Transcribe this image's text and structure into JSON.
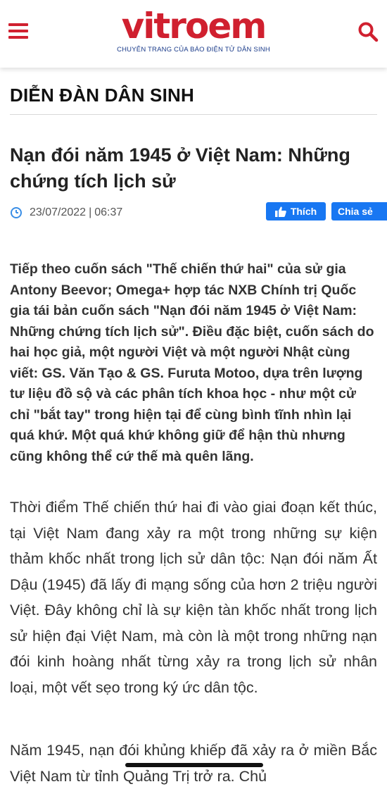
{
  "header": {
    "logo_text": "vitroem",
    "logo_tagline": "CHUYÊN TRANG CỦA BÁO ĐIỆN TỬ DÂN SINH",
    "menu_icon": "hamburger-menu-icon",
    "search_icon": "search-icon",
    "brand_color": "#d0202f",
    "tagline_color": "#1a3b8a"
  },
  "section": {
    "title": "DIỄN ĐÀN DÂN SINH"
  },
  "article": {
    "title": "Nạn đói năm 1945 ở Việt Nam: Những chứng tích lịch sử",
    "date": "23/07/2022",
    "separator": "|",
    "time": "06:37",
    "like_label": "Thích",
    "share_label": "Chia sẻ",
    "sapo": "Tiếp theo cuốn sách \"Thế chiến thứ hai\" của sử gia Antony Beevor; Omega+ hợp tác NXB Chính trị Quốc gia tái bản cuốn sách \"Nạn đói năm 1945 ở Việt Nam: Những chứng tích lịch sử\". Điều đặc biệt, cuốn sách do hai học giả, một người Việt và một người Nhật cùng viết: GS. Văn Tạo & GS. Furuta Motoo, dựa trên lượng tư liệu đồ sộ và các phân tích khoa học - như một cử chỉ \"bắt tay\" trong hiện tại để cùng bình tĩnh nhìn lại quá khứ. Một quá khứ không giữ để hận thù nhưng cũng không thể cứ thế mà quên lãng.",
    "paragraphs": [
      "Thời điểm Thế chiến thứ hai đi vào giai đoạn kết thúc, tại Việt Nam đang xảy ra một trong những sự kiện thảm khốc nhất trong lịch sử dân tộc: Nạn đói năm Ất Dậu (1945) đã lấy đi mạng sống của hơn 2 triệu người Việt. Đây không chỉ là sự kiện tàn khốc nhất trong lịch sử hiện đại Việt Nam, mà còn là một trong những nạn đói kinh hoàng nhất từng xảy ra trong lịch sử nhân loại, một vết sẹo trong ký ức dân tộc.",
      "Năm 1945, nạn đói khủng khiếp đã xảy ra ở miền Bắc Việt Nam từ tỉnh Quảng Trị trở ra. Chủ"
    ]
  },
  "colors": {
    "facebook_blue": "#1877f2",
    "clock_icon": "#3a8ee6"
  }
}
